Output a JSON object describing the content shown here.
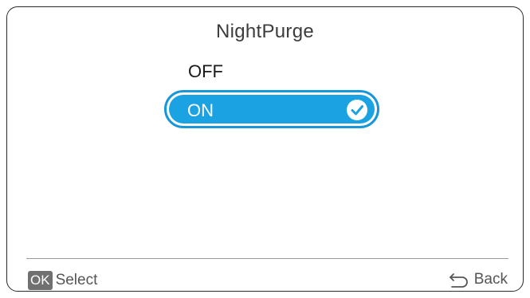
{
  "screen": {
    "title": "NightPurge"
  },
  "options": {
    "off_label": "OFF",
    "on_label": "ON",
    "selected": "ON"
  },
  "footer": {
    "ok_key": "OK",
    "select_label": "Select",
    "back_label": "Back"
  },
  "colors": {
    "accent": "#1aa2e2",
    "accent_border": "#1896d8",
    "badge": "#707070"
  },
  "icons": {
    "selected": "check-circle-icon",
    "back": "back-arrow-icon"
  }
}
